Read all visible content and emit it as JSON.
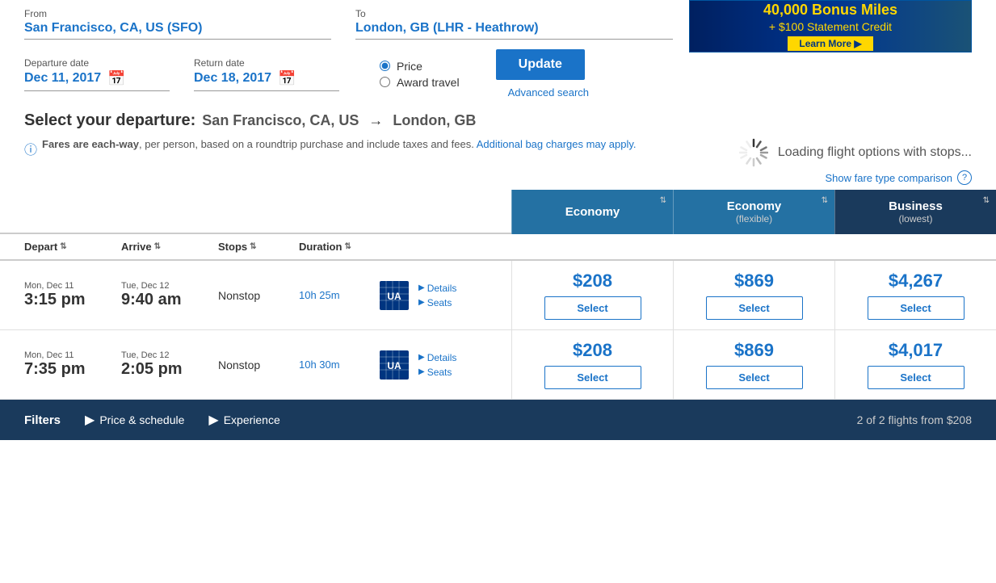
{
  "from": {
    "label": "From",
    "value": "San Francisco, CA, US (SFO)"
  },
  "to": {
    "label": "To",
    "value": "London, GB (LHR - Heathrow)"
  },
  "departure": {
    "label": "Departure date",
    "value": "Dec 11, 2017"
  },
  "return": {
    "label": "Return date",
    "value": "Dec 18, 2017"
  },
  "price_radio": "Price",
  "award_radio": "Award travel",
  "update_btn": "Update",
  "advanced_search": "Advanced search",
  "select_departure": "Select your departure:",
  "from_city": "San Francisco, CA, US",
  "arrow": "→",
  "to_city": "London, GB",
  "fare_info_bold": "Fares are each-way",
  "fare_info_text": ", per person, based on a roundtrip purchase and include taxes and fees.",
  "bag_charges": "Additional bag charges may apply.",
  "loading_text": "Loading flight options with stops...",
  "fare_comparison_link": "Show fare type comparison",
  "columns": {
    "depart": "Depart",
    "arrive": "Arrive",
    "stops": "Stops",
    "duration": "Duration"
  },
  "fare_columns": [
    {
      "title": "Economy",
      "subtitle": null
    },
    {
      "title": "Economy",
      "subtitle": "(flexible)"
    },
    {
      "title": "Business",
      "subtitle": "(lowest)"
    }
  ],
  "flights": [
    {
      "depart_date": "Mon, Dec 11",
      "depart_time": "3:15 pm",
      "arrive_date": "Tue, Dec 12",
      "arrive_time": "9:40 am",
      "stops": "Nonstop",
      "duration": "10h 25m",
      "details_link": "Details",
      "seats_link": "Seats",
      "prices": [
        "$208",
        "$869",
        "$4,267"
      ],
      "selects": [
        "Select",
        "Select",
        "Select"
      ]
    },
    {
      "depart_date": "Mon, Dec 11",
      "depart_time": "7:35 pm",
      "arrive_date": "Tue, Dec 12",
      "arrive_time": "2:05 pm",
      "stops": "Nonstop",
      "duration": "10h 30m",
      "details_link": "Details",
      "seats_link": "Seats",
      "prices": [
        "$208",
        "$869",
        "$4,017"
      ],
      "selects": [
        "Select",
        "Select",
        "Select"
      ]
    }
  ],
  "bottom_bar": {
    "filters": "Filters",
    "price_schedule": "Price & schedule",
    "experience": "Experience",
    "summary": "2 of 2 flights from $208"
  },
  "banner": {
    "top_text": "40,000 Bonus Miles",
    "bottom_text": "+ $100 Statement Credit",
    "learn_more": "Learn More ▶"
  }
}
